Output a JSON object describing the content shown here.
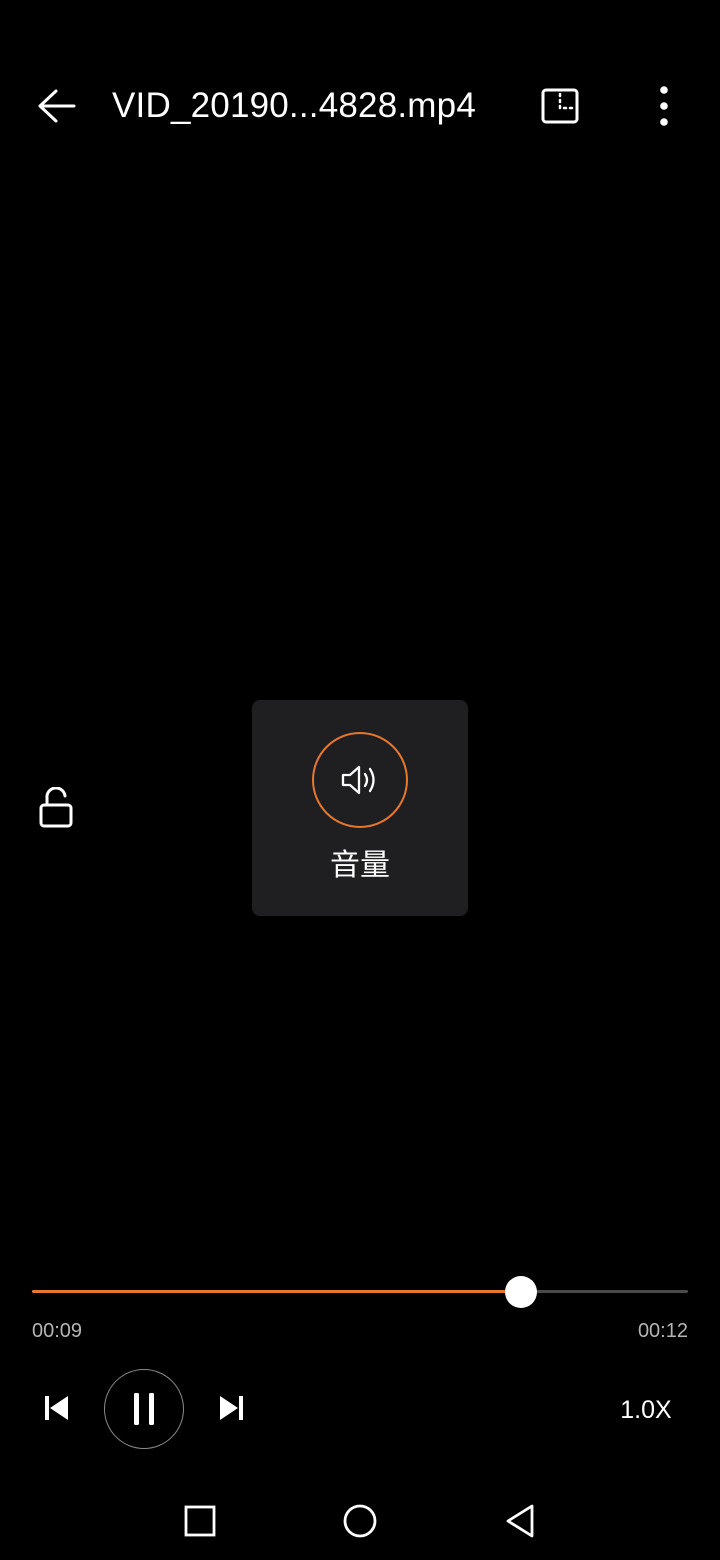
{
  "header": {
    "title": "VID_20190...4828.mp4",
    "icons": {
      "back": "arrow-left-icon",
      "pip": "picture-in-picture-icon",
      "more": "more-vertical-icon"
    }
  },
  "lock": {
    "icon": "unlock-icon"
  },
  "volume_popup": {
    "label": "音量",
    "icon": "speaker-icon",
    "accent": "#e8772e"
  },
  "playback": {
    "elapsed": "00:09",
    "total": "00:12",
    "progress_fraction": 0.745,
    "speed": "1.0X",
    "accent": "#e8772e"
  },
  "controls": {
    "icons": {
      "previous": "skip-previous-icon",
      "pause": "pause-icon",
      "next": "skip-next-icon"
    }
  },
  "navbar": {
    "icons": {
      "recent": "recent-apps-icon",
      "home": "home-icon",
      "back": "nav-back-icon"
    }
  }
}
